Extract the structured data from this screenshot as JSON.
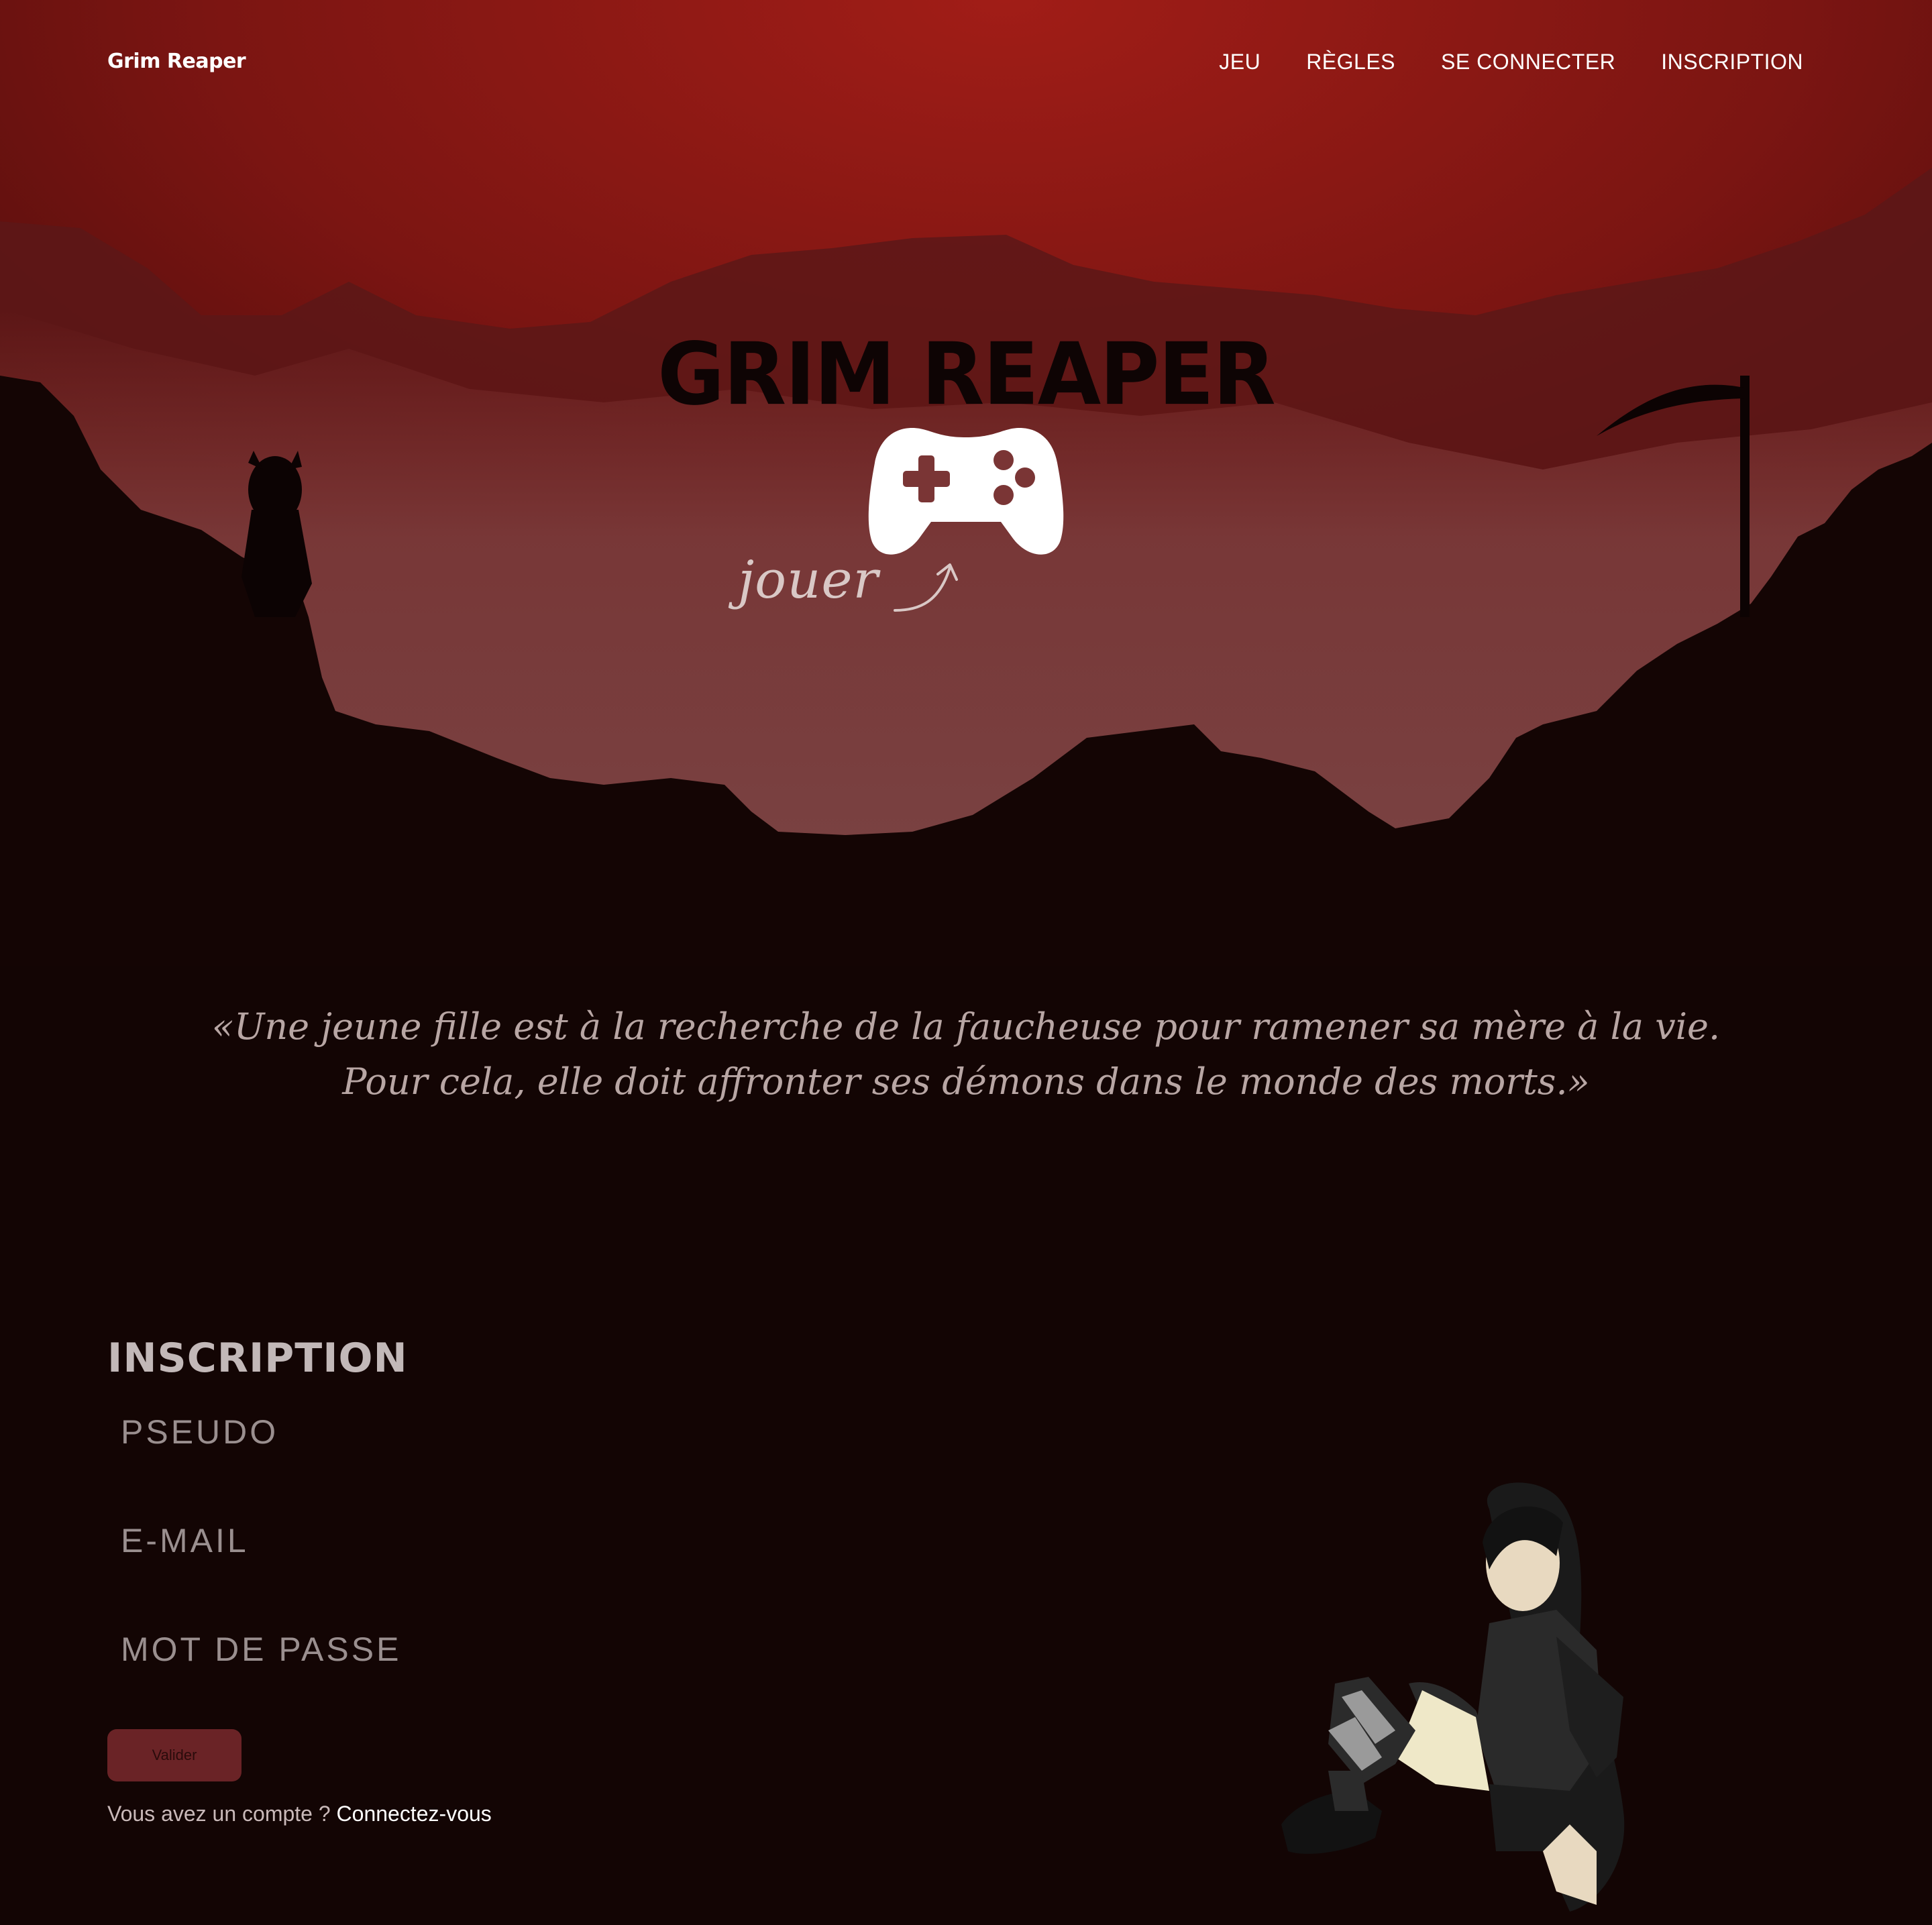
{
  "brand": "Grim Reaper",
  "nav": {
    "jeu": "JEU",
    "regles": "RÈGLES",
    "connexion": "SE CONNECTER",
    "inscription": "INSCRIPTION"
  },
  "hero": {
    "title": "GRIM REAPER",
    "play_hint": "jouer"
  },
  "synopsis": {
    "line1": "«Une jeune fille est à la recherche de la faucheuse pour ramener sa mère à la vie.",
    "line2": "Pour cela, elle doit affronter ses démons dans le monde des morts.»"
  },
  "form": {
    "title": "INSCRIPTION",
    "pseudo_placeholder": "PSEUDO",
    "email_placeholder": "E-MAIL",
    "password_placeholder": "MOT DE PASSE",
    "submit_label": "Valider",
    "account_question": "Vous avez un compte ? ",
    "account_link": "Connectez-vous"
  },
  "colors": {
    "page_background": "#130504",
    "sky_top": "#9c1c17",
    "valley": "#7a4041",
    "button": "#6a2326"
  },
  "icons": {
    "play": "gamepad-icon",
    "hint_arrow": "curved-arrow-icon"
  }
}
